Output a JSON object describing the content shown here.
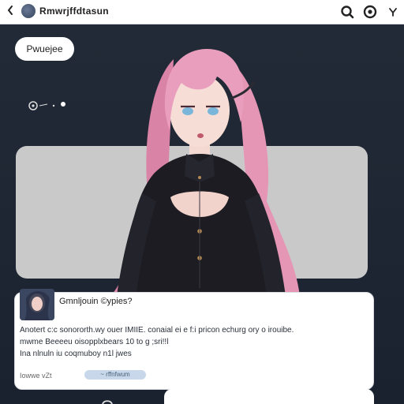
{
  "header": {
    "back_icon": "chevron-left-icon",
    "title": "Rmwrjffdtasun",
    "icons": [
      "search-icon",
      "refresh-icon",
      "filter-icon"
    ]
  },
  "chip": {
    "label": "Pwuejee"
  },
  "indicator": {
    "icons": [
      "record-icon",
      "dot-icon"
    ]
  },
  "comment": {
    "author": "Gmnljouin ©ypies?",
    "lines": [
      "Anotert c:c sonororth.wy ouer IMIIE. conaial ei e f:i pricon echurg ory o irouibe.",
      "mwme Beeeeu oisopplxbears 10 to g ;sri!!l",
      "Ina nlnuln iu coqmuboy n1l jwes"
    ],
    "meta": "Iowwe vZt",
    "tag": "~  rffnfwum"
  },
  "colors": {
    "topbar": "#ffffff",
    "stage": "#1f2734",
    "panel": "#c9c9c9",
    "hair": "#e99bb8",
    "outfit": "#1c1c22",
    "accent": "#e8508c"
  }
}
